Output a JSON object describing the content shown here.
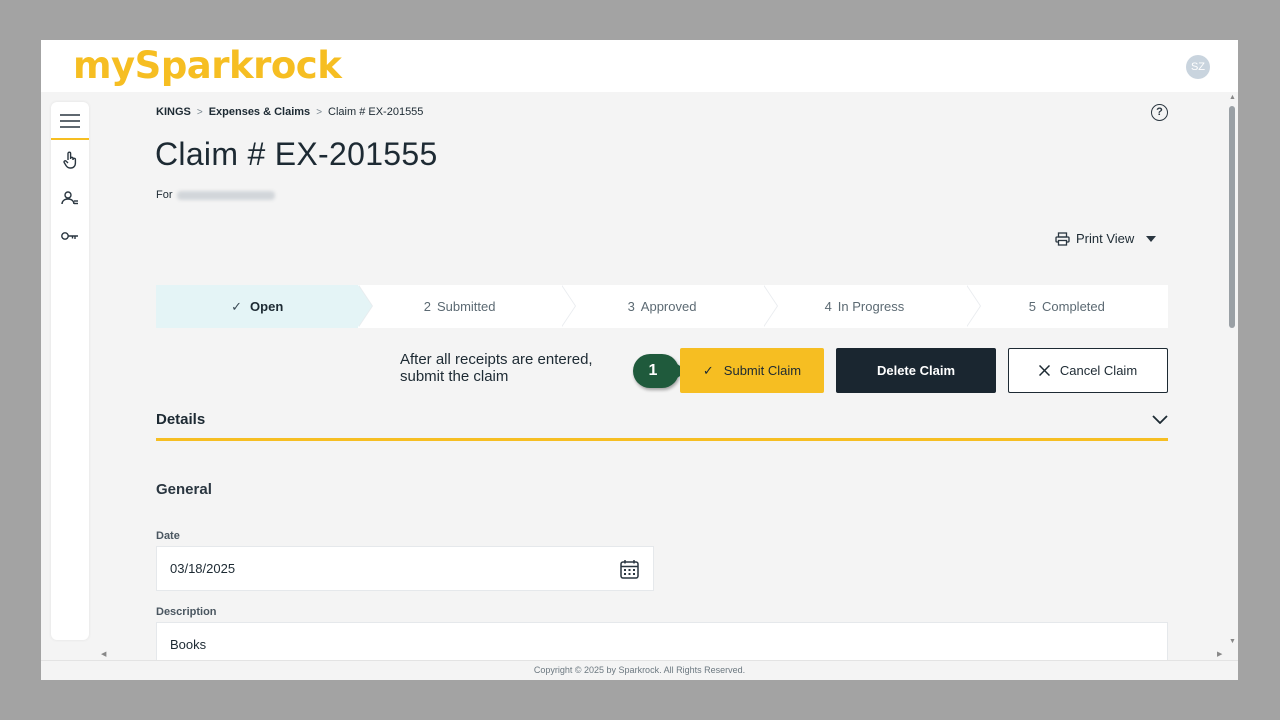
{
  "app": {
    "logo_text": "mySparkrock",
    "user_initials": "SZ",
    "brand_color": "#f6be22"
  },
  "sidebar": {
    "items": [
      {
        "icon": "hamburger-menu-icon"
      },
      {
        "icon": "pointer-hand-icon"
      },
      {
        "icon": "user-group-icon"
      },
      {
        "icon": "key-icon"
      }
    ]
  },
  "breadcrumb": {
    "items": [
      "KINGS",
      "Expenses & Claims",
      "Claim # EX-201555"
    ],
    "separator": ">"
  },
  "header": {
    "title": "Claim # EX-201555",
    "for_label": "For",
    "help_glyph": "?",
    "print_view_label": "Print View"
  },
  "stepper": {
    "steps": [
      {
        "number": "",
        "label": "Open",
        "state": "completed"
      },
      {
        "number": "2",
        "label": "Submitted",
        "state": "pending"
      },
      {
        "number": "3",
        "label": "Approved",
        "state": "pending"
      },
      {
        "number": "4",
        "label": "In Progress",
        "state": "pending"
      },
      {
        "number": "5",
        "label": "Completed",
        "state": "pending"
      }
    ]
  },
  "callout": {
    "line1": "After all receipts are entered,",
    "line2": "submit the claim",
    "badge": "1",
    "badge_color": "#1f5a3c"
  },
  "actions": {
    "submit_label": "Submit Claim",
    "delete_label": "Delete Claim",
    "cancel_label": "Cancel Claim"
  },
  "details": {
    "section_label": "Details",
    "group_label": "General",
    "date_label": "Date",
    "date_value": "03/18/2025",
    "description_label": "Description",
    "description_value": "Books"
  },
  "footer": {
    "text": "Copyright © 2025 by Sparkrock. All Rights Reserved."
  }
}
